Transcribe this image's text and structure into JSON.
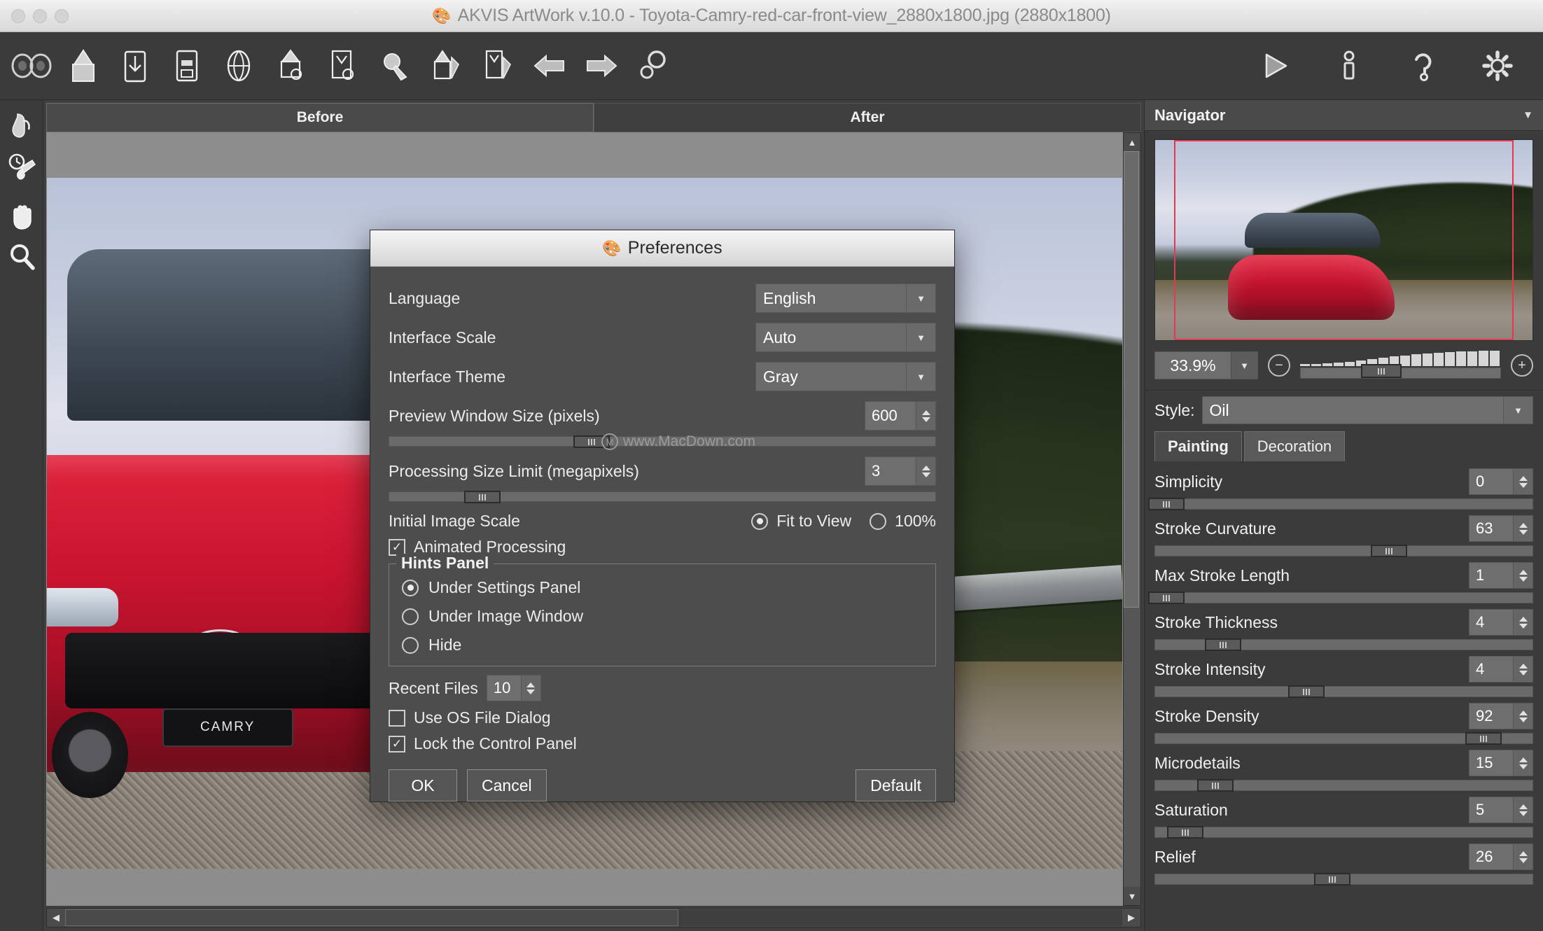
{
  "window": {
    "title": "AKVIS ArtWork v.10.0 - Toyota-Camry-red-car-front-view_2880x1800.jpg (2880x1800)",
    "app_icon": "akvis-artwork-icon",
    "traffic_lights": [
      "close",
      "minimize",
      "zoom"
    ]
  },
  "toolbar": {
    "left_buttons": [
      {
        "name": "akvis-logo",
        "label": "AKVIS ArtWork"
      },
      {
        "name": "open-image-button",
        "label": "Open Image"
      },
      {
        "name": "save-image-button",
        "label": "Save Image"
      },
      {
        "name": "print-image-button",
        "label": "Print Image"
      },
      {
        "name": "publish-web-button",
        "label": "Publish to Web"
      },
      {
        "name": "import-preset-button",
        "label": "Import Preset"
      },
      {
        "name": "export-preset-button",
        "label": "Export Preset"
      },
      {
        "name": "history-brush-button",
        "label": "History Brush"
      },
      {
        "name": "copy-settings-button",
        "label": "Copy Settings"
      },
      {
        "name": "paste-settings-button",
        "label": "Paste Settings"
      },
      {
        "name": "undo-button",
        "label": "Undo"
      },
      {
        "name": "redo-button",
        "label": "Redo"
      },
      {
        "name": "batch-processing-button",
        "label": "Batch Processing"
      }
    ],
    "right_buttons": [
      {
        "name": "run-button",
        "label": "Run"
      },
      {
        "name": "about-button",
        "label": "About"
      },
      {
        "name": "help-button",
        "label": "Help"
      },
      {
        "name": "preferences-button",
        "label": "Preferences"
      }
    ]
  },
  "tools": [
    {
      "name": "smudge-tool",
      "label": "Smudge"
    },
    {
      "name": "history-brush-tool",
      "label": "History Brush"
    },
    {
      "name": "hand-tool",
      "label": "Hand"
    },
    {
      "name": "zoom-tool",
      "label": "Zoom"
    }
  ],
  "image_tabs": {
    "before": "Before",
    "after": "After",
    "active": "After"
  },
  "navigator": {
    "title": "Navigator",
    "zoom_value": "33.9%",
    "zoom_out_icon": "minus-circle-icon",
    "zoom_in_icon": "plus-circle-icon"
  },
  "style": {
    "label": "Style:",
    "value": "Oil"
  },
  "settings_tabs": {
    "painting": "Painting",
    "decoration": "Decoration",
    "active": "Painting"
  },
  "parameters": [
    {
      "name": "Simplicity",
      "value": "0",
      "pos": 3
    },
    {
      "name": "Stroke Curvature",
      "value": "63",
      "pos": 62
    },
    {
      "name": "Max Stroke Length",
      "value": "1",
      "pos": 3
    },
    {
      "name": "Stroke Thickness",
      "value": "4",
      "pos": 18
    },
    {
      "name": "Stroke Intensity",
      "value": "4",
      "pos": 40
    },
    {
      "name": "Stroke Density",
      "value": "92",
      "pos": 87
    },
    {
      "name": "Microdetails",
      "value": "15",
      "pos": 16
    },
    {
      "name": "Saturation",
      "value": "5",
      "pos": 8
    },
    {
      "name": "Relief",
      "value": "26",
      "pos": 47
    }
  ],
  "preferences": {
    "title": "Preferences",
    "icon": "akvis-artwork-icon",
    "language": {
      "label": "Language",
      "value": "English"
    },
    "interface_scale": {
      "label": "Interface Scale",
      "value": "Auto"
    },
    "interface_theme": {
      "label": "Interface Theme",
      "value": "Gray"
    },
    "preview_window_size": {
      "label": "Preview Window Size (pixels)",
      "value": "600",
      "pos": 37
    },
    "processing_size_limit": {
      "label": "Processing Size Limit (megapixels)",
      "value": "3",
      "pos": 17
    },
    "initial_image_scale": {
      "label": "Initial Image Scale",
      "option_fit": "Fit to View",
      "option_100": "100%",
      "selected": "Fit to View"
    },
    "animated_processing": {
      "label": "Animated Processing",
      "checked": true
    },
    "hints_panel": {
      "legend": "Hints Panel",
      "options": [
        {
          "label": "Under Settings Panel",
          "selected": true
        },
        {
          "label": "Under Image Window",
          "selected": false
        },
        {
          "label": "Hide",
          "selected": false
        }
      ]
    },
    "recent_files": {
      "label": "Recent Files",
      "value": "10"
    },
    "use_os_file_dialog": {
      "label": "Use OS File Dialog",
      "checked": false
    },
    "lock_control_panel": {
      "label": "Lock the Control Panel",
      "checked": true
    },
    "buttons": {
      "ok": "OK",
      "cancel": "Cancel",
      "default": "Default"
    },
    "watermark": "www.MacDown.com"
  },
  "colors": {
    "window_bg": "#3b3b3b",
    "panel_bg": "#4a4a4a",
    "dialog_bg": "#4d4d4d",
    "text": "#f0f0f0",
    "accent_red": "#e8384f"
  }
}
